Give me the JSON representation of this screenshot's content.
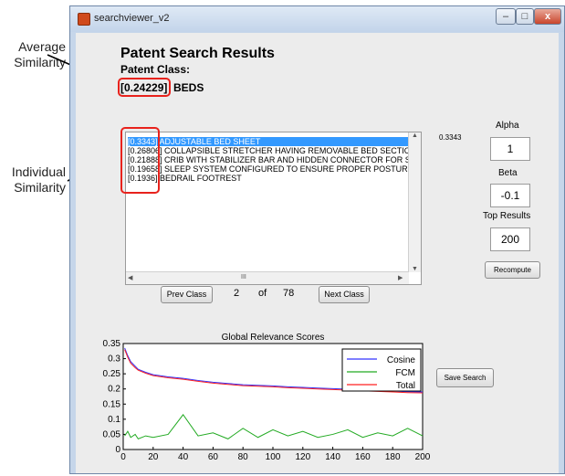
{
  "annotations": {
    "average_label": "Average\nSimilarity",
    "individual_label": "Individual\nSimilarity"
  },
  "window": {
    "title": "searchviewer_v2",
    "controls": {
      "minimize": "–",
      "maximize": "□",
      "close": "x"
    }
  },
  "header": {
    "title": "Patent Search Results",
    "class_label": "Patent Class:",
    "class_score": "[0.24229]",
    "class_name": "BEDS"
  },
  "results": [
    {
      "score": "[0.3343]",
      "text": "ADJUSTABLE BED SHEET",
      "selected": true
    },
    {
      "score": "[0.26806]",
      "text": "COLLAPSIBLE STRETCHER HAVING REMOVABLE BED SECTION",
      "selected": false
    },
    {
      "score": "[0.21888]",
      "text": "CRIB WITH STABILIZER BAR AND HIDDEN CONNECTOR FOR STA",
      "selected": false
    },
    {
      "score": "[0.19658]",
      "text": "SLEEP SYSTEM CONFIGURED TO ENSURE PROPER POSTURE W",
      "selected": false
    },
    {
      "score": "[0.1936]",
      "text": "BEDRAIL FOOTREST",
      "selected": false
    }
  ],
  "selected_score": "0.3343",
  "pager": {
    "prev_label": "Prev Class",
    "current": "2",
    "of_label": "of",
    "total": "78",
    "next_label": "Next Class"
  },
  "params": {
    "alpha_label": "Alpha",
    "alpha_value": "1",
    "beta_label": "Beta",
    "beta_value": "-0.1",
    "top_label": "Top Results",
    "top_value": "200",
    "recompute_label": "Recompute"
  },
  "save_label": "Save Search",
  "chart_data": {
    "type": "line",
    "title": "Global Relevance Scores",
    "xlim": [
      0,
      200
    ],
    "ylim": [
      0,
      0.35
    ],
    "x_ticks": [
      0,
      20,
      40,
      60,
      80,
      100,
      120,
      140,
      160,
      180,
      200
    ],
    "y_ticks": [
      0,
      0.05,
      0.1,
      0.15,
      0.2,
      0.25,
      0.3,
      0.35
    ],
    "y_tick_labels": [
      "0",
      "0.05",
      "0.1",
      "0.15",
      "0.2",
      "0.25",
      "0.3",
      "0.35"
    ],
    "legend_position": "top-right",
    "x": [
      1,
      3,
      5,
      8,
      10,
      15,
      20,
      30,
      40,
      50,
      60,
      70,
      80,
      90,
      100,
      110,
      120,
      130,
      140,
      150,
      160,
      170,
      180,
      190,
      200
    ],
    "series": [
      {
        "name": "Cosine",
        "color": "#3333ff",
        "values": [
          0.335,
          0.31,
          0.29,
          0.275,
          0.265,
          0.255,
          0.247,
          0.24,
          0.235,
          0.228,
          0.222,
          0.218,
          0.214,
          0.212,
          0.21,
          0.207,
          0.205,
          0.203,
          0.201,
          0.199,
          0.197,
          0.195,
          0.193,
          0.191,
          0.19
        ]
      },
      {
        "name": "FCM",
        "color": "#22aa22",
        "values": [
          0.045,
          0.06,
          0.04,
          0.05,
          0.035,
          0.045,
          0.04,
          0.05,
          0.115,
          0.045,
          0.055,
          0.035,
          0.07,
          0.04,
          0.065,
          0.045,
          0.06,
          0.04,
          0.05,
          0.065,
          0.04,
          0.055,
          0.045,
          0.07,
          0.045
        ]
      },
      {
        "name": "Total",
        "color": "#ff2222",
        "values": [
          0.33,
          0.305,
          0.285,
          0.27,
          0.262,
          0.252,
          0.244,
          0.237,
          0.232,
          0.225,
          0.219,
          0.215,
          0.211,
          0.209,
          0.207,
          0.204,
          0.202,
          0.2,
          0.198,
          0.196,
          0.194,
          0.192,
          0.19,
          0.188,
          0.187
        ]
      }
    ]
  }
}
